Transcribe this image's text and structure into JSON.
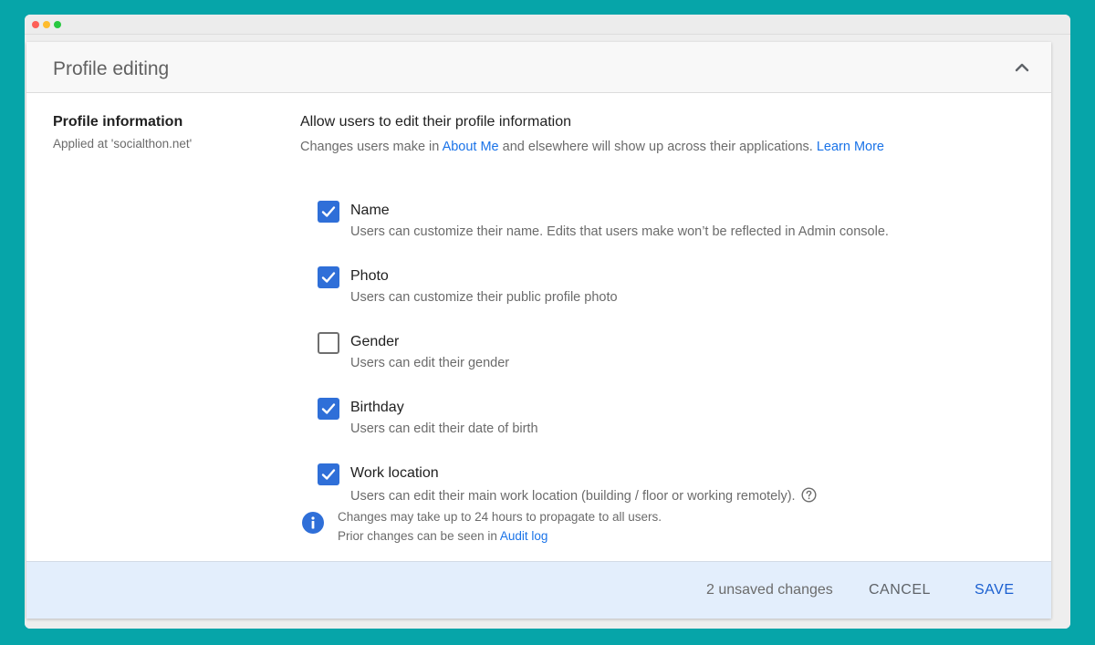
{
  "card": {
    "title": "Profile editing"
  },
  "section": {
    "title": "Profile information",
    "subtitle": "Applied at 'socialthon.net'"
  },
  "main": {
    "heading": "Allow users to edit their profile information",
    "desc_prefix": "Changes users make in ",
    "about_me_link": "About Me",
    "desc_middle": " and elsewhere will show up across their applications. ",
    "learn_more_link": "Learn More"
  },
  "options": [
    {
      "label": "Name",
      "desc": "Users can customize their name. Edits that users make won’t be reflected in Admin console.",
      "checked": true
    },
    {
      "label": "Photo",
      "desc": "Users can customize their public profile photo",
      "checked": true
    },
    {
      "label": "Gender",
      "desc": "Users can edit their gender",
      "checked": false
    },
    {
      "label": "Birthday",
      "desc": "Users can edit their date of birth",
      "checked": true
    },
    {
      "label": "Work location",
      "desc": "Users can edit their main work location (building / floor or working remotely).",
      "checked": true
    }
  ],
  "info": {
    "line1": "Changes may take up to 24 hours to propagate to all users.",
    "line2_prefix": "Prior changes can be seen in ",
    "audit_log_link": "Audit log"
  },
  "footer": {
    "unsaved": "2 unsaved changes",
    "cancel": "CANCEL",
    "save": "SAVE"
  },
  "icons": {
    "collapse": "chevron-up-icon",
    "checkbox_checked": "check-icon",
    "help": "help-circle-icon",
    "info": "info-icon"
  },
  "colors": {
    "background": "#06a5a9",
    "accent": "#2f6fd8",
    "link": "#1a73e8",
    "footer_bg": "#e3eefc"
  }
}
